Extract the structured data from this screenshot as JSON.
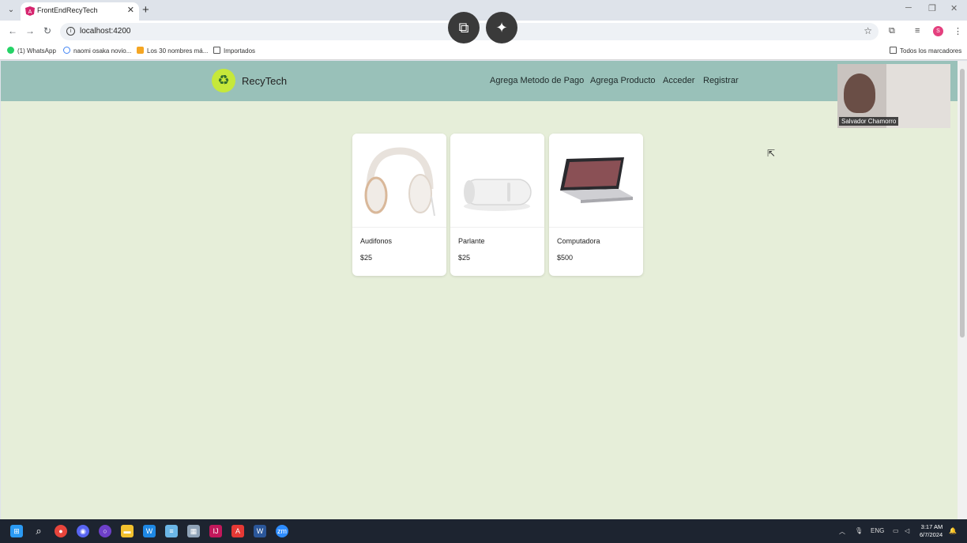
{
  "browser": {
    "tab_title": "FrontEndRecyTech",
    "url": "localhost:4200",
    "bookmarks": [
      "(1) WhatsApp",
      "naomi osaka novio...",
      "Los 30 nombres má...",
      "Importados"
    ],
    "all_bookmarks": "Todos los marcadores",
    "profile_initial": "S"
  },
  "app": {
    "brand": "RecyTech",
    "nav": [
      "Agrega Metodo de Pago",
      "Agrega Producto",
      "Acceder",
      "Registrar"
    ]
  },
  "products": [
    {
      "name": "Audifonos",
      "price": "$25"
    },
    {
      "name": "Parlante",
      "price": "$25"
    },
    {
      "name": "Computadora",
      "price": "$500"
    }
  ],
  "video": {
    "participant": "Salvador Chamorro"
  },
  "taskbar": {
    "language": "ENG",
    "time": "3:17 AM",
    "date": "6/7/2024"
  },
  "colors": {
    "header": "#99c1b9",
    "page_bg": "#e6eed9",
    "logo": "#c6e83a"
  }
}
